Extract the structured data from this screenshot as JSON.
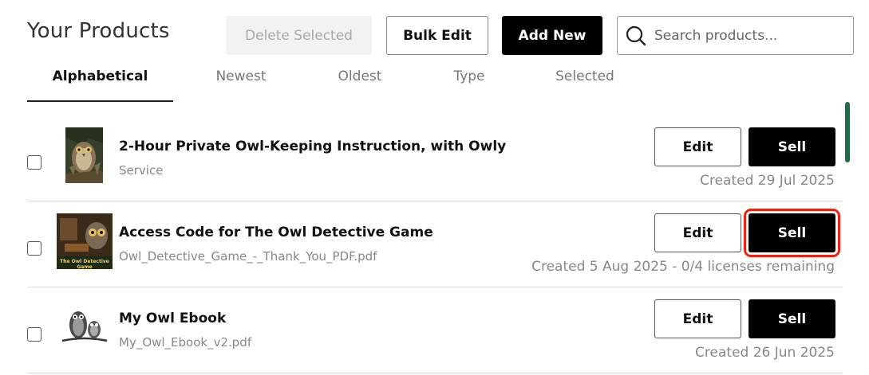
{
  "header": {
    "title": "Your Products",
    "delete_label": "Delete Selected",
    "bulk_edit_label": "Bulk Edit",
    "add_new_label": "Add New",
    "search_placeholder": "Search products..."
  },
  "tabs": [
    {
      "label": "Alphabetical",
      "active": true
    },
    {
      "label": "Newest",
      "active": false
    },
    {
      "label": "Oldest",
      "active": false
    },
    {
      "label": "Type",
      "active": false
    },
    {
      "label": "Selected",
      "active": false
    }
  ],
  "products": [
    {
      "name": "2-Hour Private Owl-Keeping Instruction, with Owly",
      "subtitle": "Service",
      "created": "Created 29 Jul 2025",
      "edit_label": "Edit",
      "sell_label": "Sell",
      "thumb_icon": "owl-painting-thumbnail"
    },
    {
      "name": "Access Code for The Owl Detective Game",
      "subtitle": "Owl_Detective_Game_-_Thank_You_PDF.pdf",
      "created": "Created 5 Aug 2025 - 0/4 licenses remaining",
      "edit_label": "Edit",
      "sell_label": "Sell",
      "thumb_icon": "owl-detective-game-thumbnail",
      "thumb_text": "The Owl Detective Game"
    },
    {
      "name": "My Owl Ebook",
      "subtitle": "My_Owl_Ebook_v2.pdf",
      "created": "Created 26 Jun 2025",
      "edit_label": "Edit",
      "sell_label": "Sell",
      "thumb_icon": "owl-sketch-thumbnail"
    }
  ],
  "colors": {
    "primary": "#000000",
    "highlight": "#ee2211",
    "scroll_indicator": "#1f6b4a"
  }
}
